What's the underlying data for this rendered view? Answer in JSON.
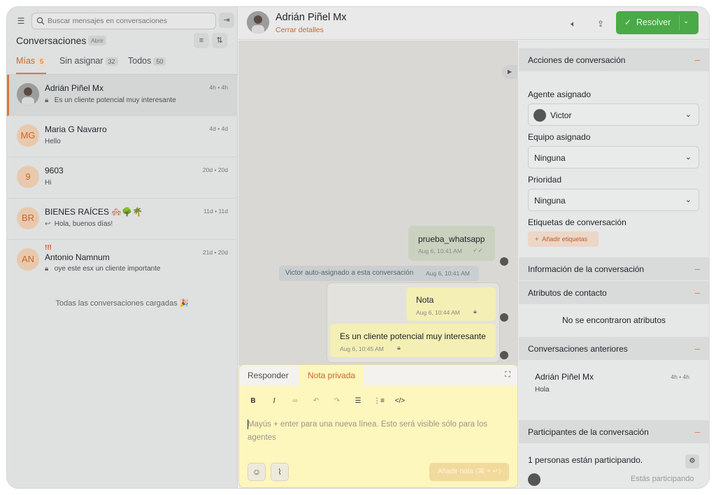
{
  "search": {
    "placeholder": "Buscar mensajes en conversaciones"
  },
  "sidebar": {
    "title": "Conversaciones",
    "status": "Abrir",
    "tabs": [
      {
        "label": "Mías",
        "count": "5"
      },
      {
        "label": "Sin asignar",
        "count": "32"
      },
      {
        "label": "Todos",
        "count": "50"
      }
    ],
    "conversations": [
      {
        "name": "Adrián Piñel Mx",
        "time": "4h • 4h",
        "preview": "Es un cliente potencial muy interesante",
        "initials": "",
        "icon": "lock-icon"
      },
      {
        "name": "Maria G Navarro",
        "time": "4d • 4d",
        "preview": "Hello",
        "initials": "MG",
        "icon": ""
      },
      {
        "name": "9603",
        "time": "20d • 20d",
        "preview": "Hi",
        "initials": "9",
        "icon": ""
      },
      {
        "name": "BIENES RAÍCES 🏘️🌳🌴",
        "time": "11d • 11d",
        "preview": "Hola, buenos días!",
        "initials": "BR",
        "icon": "reply-icon"
      },
      {
        "name": "Antonio Namnum",
        "time": "21d • 20d",
        "preview": "oye este esx un cliente importante",
        "initials": "AN",
        "icon": "lock-icon",
        "priority": "!!!"
      }
    ],
    "loaded_message": "Todas las conversaciones cargadas 🎉"
  },
  "header": {
    "contact_name": "Adrián Piñel Mx",
    "details_link": "Cerrar detalles",
    "resolve_label": "Resolver"
  },
  "chat": {
    "messages": [
      {
        "text": "prueba_whatsapp",
        "meta": "Aug 6, 10:41 AM"
      }
    ],
    "activity": {
      "text": "Victor auto-asignado a esta conversación",
      "time": "Aug 6, 10:41 AM"
    },
    "notes": [
      {
        "text": "Nota",
        "meta": "Aug 6, 10:44 AM"
      },
      {
        "text": "Es un cliente potencial muy interesante",
        "meta": "Aug 6, 10:45 AM"
      }
    ]
  },
  "editor": {
    "tabs": [
      "Responder",
      "Nota privada"
    ],
    "placeholder": "Mayús + enter para una nueva línea. Esto será visible sólo para los agentes",
    "submit_label": "Añadir nota (⌘ + ↵)"
  },
  "panel": {
    "actions_title": "Acciones de conversación",
    "agent_label": "Agente asignado",
    "agent_value": "Victor",
    "team_label": "Equipo asignado",
    "team_value": "Ninguna",
    "priority_label": "Prioridad",
    "priority_value": "Ninguna",
    "labels_title": "Etiquetas de conversación",
    "add_labels": "Añadir etiquetas",
    "info_title": "Información de la conversación",
    "attributes_title": "Atributos de contacto",
    "no_attributes": "No se encontraron atributos",
    "previous_title": "Conversaciones anteriores",
    "previous": {
      "name": "Adrián Piñel Mx",
      "time": "4h • 4h",
      "message": "Hola"
    },
    "participants_title": "Participantes de la conversación",
    "participants_text": "1 personas están participando.",
    "participating": "Estás participando"
  },
  "colors": {
    "accent": "#d8793d",
    "resolve": "#4aaa46",
    "note": "#fdf6bd"
  }
}
